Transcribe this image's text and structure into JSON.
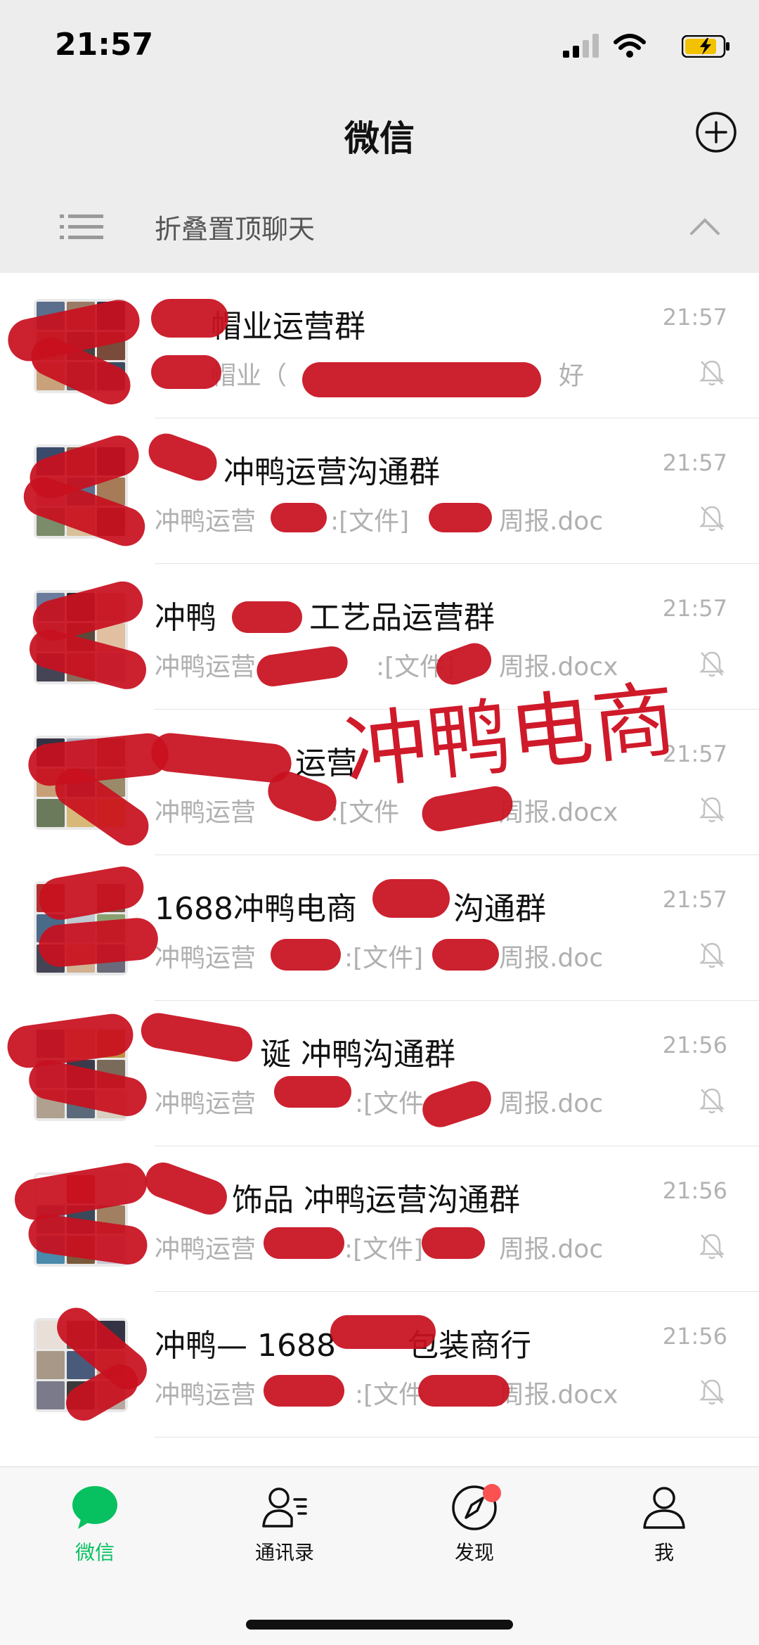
{
  "status": {
    "time": "21:57"
  },
  "nav": {
    "title": "微信"
  },
  "pinned": {
    "label": "折叠置顶聊天"
  },
  "chats": [
    {
      "title": "帽业运营群",
      "preview": "帽业（",
      "preview_tail": "好",
      "time": "21:57"
    },
    {
      "title": "冲鸭运营沟通群",
      "preview": "冲鸭运营",
      "preview_tail": ":[文件]",
      "preview_end": "周报.doc",
      "time": "21:57"
    },
    {
      "title": "冲鸭",
      "title_tail": "工艺品运营群",
      "preview": "冲鸭运营",
      "preview_tail": ":[文件]",
      "preview_end": "周报.docx",
      "time": "21:57"
    },
    {
      "title": "运营",
      "preview": "冲鸭运营",
      "preview_tail": ":[文件",
      "preview_end": "周报.docx",
      "time": "21:57"
    },
    {
      "title": "1688冲鸭电商",
      "title_tail": "沟通群",
      "preview": "冲鸭运营",
      "preview_tail": ":[文件]",
      "preview_end": "周报.doc",
      "time": "21:57"
    },
    {
      "title": "诞 冲鸭沟通群",
      "preview": "冲鸭运营",
      "preview_tail": ":[文件",
      "preview_end": "周报.doc",
      "time": "21:56"
    },
    {
      "title": "饰品 冲鸭运营沟通群",
      "preview": "冲鸭运营",
      "preview_tail": ":[文件]",
      "preview_end": "周报.doc",
      "time": "21:56"
    },
    {
      "title": "冲鸭— 1688",
      "title_tail": "包装商行",
      "preview": "冲鸭运营",
      "preview_tail": ":[文件",
      "preview_end": "周报.docx",
      "time": "21:56"
    }
  ],
  "watermark": "冲鸭电商",
  "tabs": [
    {
      "label": "微信"
    },
    {
      "label": "通讯录"
    },
    {
      "label": "发现"
    },
    {
      "label": "我"
    }
  ],
  "colors": {
    "accent": "#07c160",
    "redaction": "#c8101f",
    "badge": "#fa5151"
  }
}
